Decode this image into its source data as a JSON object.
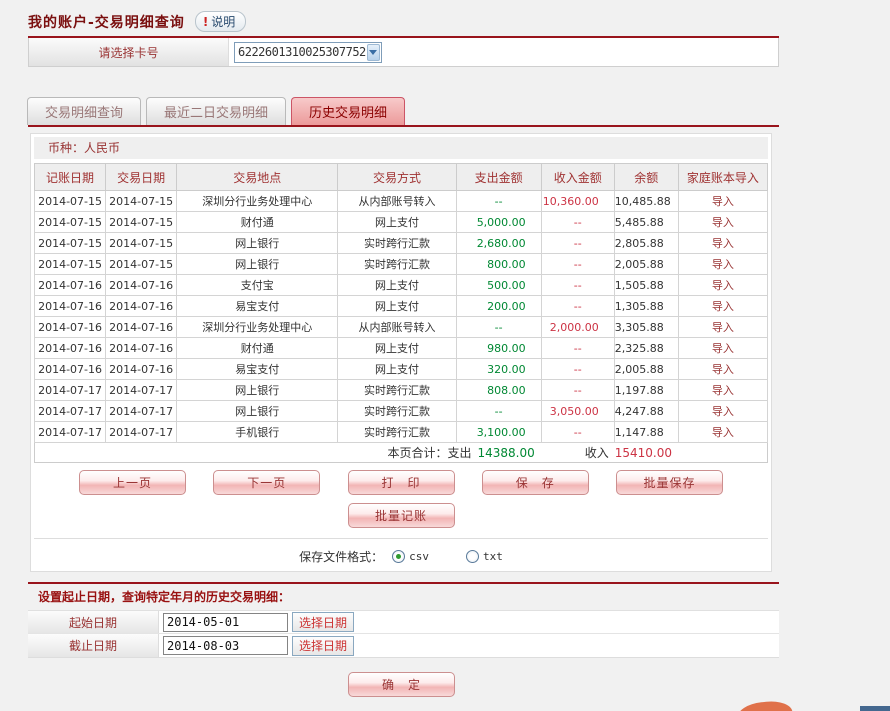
{
  "page": {
    "title": "我的账户-交易明细查询",
    "help_button_label": "说明",
    "help_button_icon": "!"
  },
  "card_selector": {
    "label": "请选择卡号",
    "selected_value": "6222601310025307752"
  },
  "tabs": [
    {
      "label": "交易明细查询",
      "active": false
    },
    {
      "label": "最近二日交易明细",
      "active": false
    },
    {
      "label": "历史交易明细",
      "active": true
    }
  ],
  "currency_bar_label": "币种：人民币",
  "table": {
    "headers": [
      "记账日期",
      "交易日期",
      "交易地点",
      "交易方式",
      "支出金额",
      "收入金额",
      "余额",
      "家庭账本导入"
    ],
    "rows": [
      [
        "2014-07-15",
        "2014-07-15",
        "深圳分行业务处理中心",
        "从内部账号转入",
        "--",
        "10,360.00",
        "10,485.88",
        "导入"
      ],
      [
        "2014-07-15",
        "2014-07-15",
        "财付通",
        "网上支付",
        "5,000.00",
        "--",
        "5,485.88",
        "导入"
      ],
      [
        "2014-07-15",
        "2014-07-15",
        "网上银行",
        "实时跨行汇款",
        "2,680.00",
        "--",
        "2,805.88",
        "导入"
      ],
      [
        "2014-07-15",
        "2014-07-15",
        "网上银行",
        "实时跨行汇款",
        "800.00",
        "--",
        "2,005.88",
        "导入"
      ],
      [
        "2014-07-16",
        "2014-07-16",
        "支付宝",
        "网上支付",
        "500.00",
        "--",
        "1,505.88",
        "导入"
      ],
      [
        "2014-07-16",
        "2014-07-16",
        "易宝支付",
        "网上支付",
        "200.00",
        "--",
        "1,305.88",
        "导入"
      ],
      [
        "2014-07-16",
        "2014-07-16",
        "深圳分行业务处理中心",
        "从内部账号转入",
        "--",
        "2,000.00",
        "3,305.88",
        "导入"
      ],
      [
        "2014-07-16",
        "2014-07-16",
        "财付通",
        "网上支付",
        "980.00",
        "--",
        "2,325.88",
        "导入"
      ],
      [
        "2014-07-16",
        "2014-07-16",
        "易宝支付",
        "网上支付",
        "320.00",
        "--",
        "2,005.88",
        "导入"
      ],
      [
        "2014-07-17",
        "2014-07-17",
        "网上银行",
        "实时跨行汇款",
        "808.00",
        "--",
        "1,197.88",
        "导入"
      ],
      [
        "2014-07-17",
        "2014-07-17",
        "网上银行",
        "实时跨行汇款",
        "--",
        "3,050.00",
        "4,247.88",
        "导入"
      ],
      [
        "2014-07-17",
        "2014-07-17",
        "手机银行",
        "实时跨行汇款",
        "3,100.00",
        "--",
        "1,147.88",
        "导入"
      ]
    ],
    "summary": {
      "prefix": "本页合计：支出",
      "outgoing_total": "14388.00",
      "incoming_label": "收入",
      "incoming_total": "15410.00"
    }
  },
  "buttons": {
    "prev_page": "上一页",
    "next_page": "下一页",
    "print": "打　印",
    "save": "保　存",
    "batch_save": "批量保存",
    "batch_record": "批量记账",
    "confirm": "确　定"
  },
  "file_format": {
    "label": "保存文件格式：",
    "options": [
      {
        "label": "csv",
        "selected": true
      },
      {
        "label": "txt",
        "selected": false
      }
    ]
  },
  "date_section": {
    "title": "设置起止日期，查询特定年月的历史交易明细：",
    "start_row": {
      "label": "起始日期",
      "value": "2014-05-01",
      "button": "选择日期"
    },
    "end_row": {
      "label": "截止日期",
      "value": "2014-08-03",
      "button": "选择日期"
    }
  },
  "colors": {
    "accent_red": "#99141c",
    "amount_out_green": "#008833",
    "amount_in_red": "#cc3344",
    "link_red": "#993333"
  }
}
